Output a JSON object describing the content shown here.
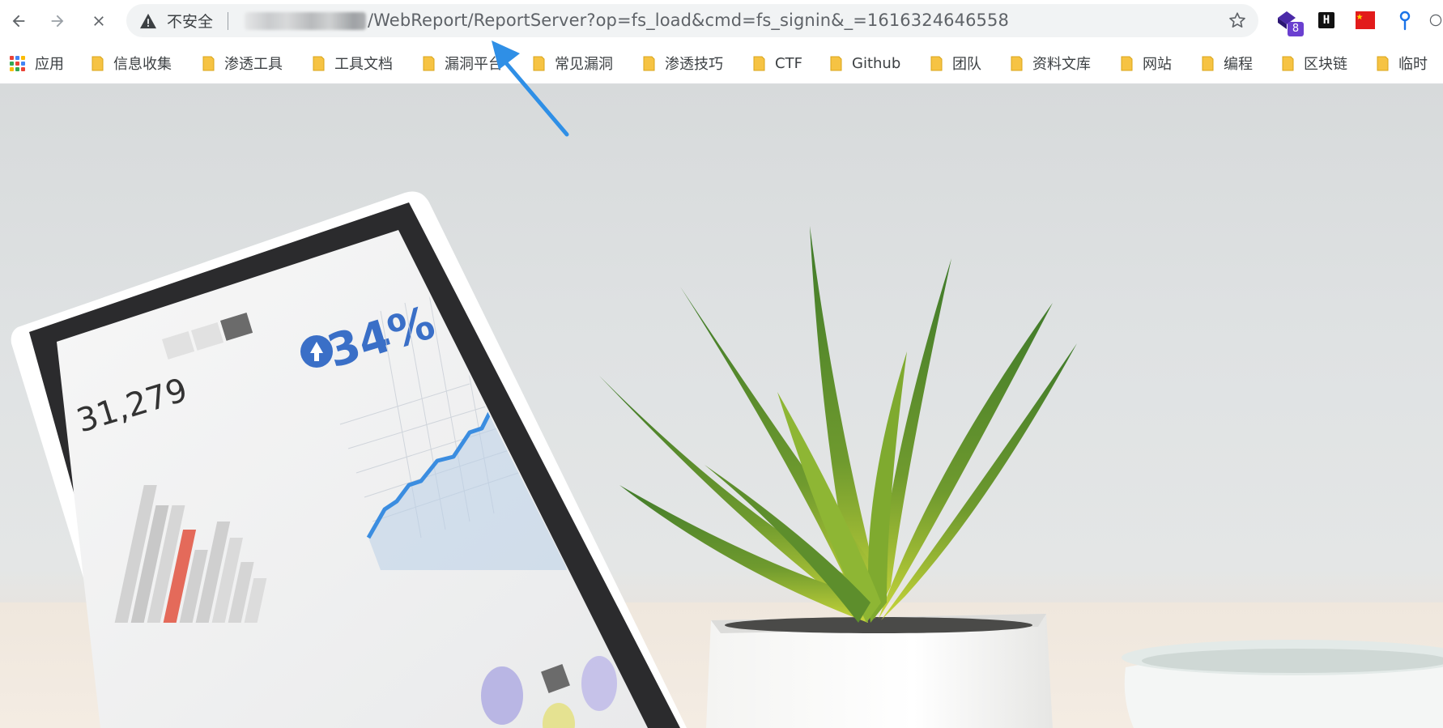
{
  "browser": {
    "nav": {
      "back_icon": "arrow-left-icon",
      "forward_icon": "arrow-right-icon",
      "stop_icon": "close-icon"
    },
    "omnibox": {
      "security_label": "不安全",
      "url_visible": "/WebReport/ReportServer?op=fs_load&cmd=fs_signin&_=1616324646558",
      "star_icon": "star-icon"
    },
    "extensions": [
      {
        "name": "extension-purple-icon",
        "badge": "8"
      },
      {
        "name": "extension-h-icon",
        "label": "H"
      },
      {
        "name": "extension-china-flag-icon"
      },
      {
        "name": "extension-location-icon"
      }
    ]
  },
  "bookmarks": {
    "apps_label": "应用",
    "items": [
      {
        "label": "信息收集"
      },
      {
        "label": "渗透工具"
      },
      {
        "label": "工具文档"
      },
      {
        "label": "漏洞平台"
      },
      {
        "label": "常见漏洞"
      },
      {
        "label": "渗透技巧"
      },
      {
        "label": "CTF"
      },
      {
        "label": "Github"
      },
      {
        "label": "团队"
      },
      {
        "label": "资料文库"
      },
      {
        "label": "网站"
      },
      {
        "label": "编程"
      },
      {
        "label": "区块链"
      },
      {
        "label": "临时"
      }
    ]
  },
  "page": {
    "laptop": {
      "big_number": "31,279",
      "percent": "34%"
    }
  },
  "colors": {
    "accent_annotation": "#2f8fe6",
    "folder": "#f6c343",
    "plant": "#6f9a2e"
  }
}
